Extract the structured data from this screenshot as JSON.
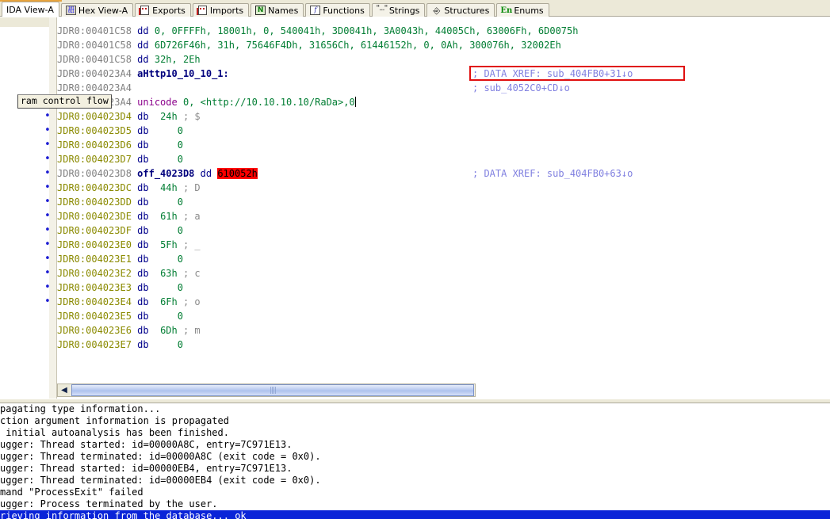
{
  "window": {
    "title": "IDA View-A disassembly"
  },
  "tabs": [
    {
      "label": "IDA View-A",
      "icon": "ida-view-icon",
      "active": true,
      "name": "tab-ida-view-a"
    },
    {
      "label": "Hex View-A",
      "icon": "hex-view-icon",
      "active": false,
      "name": "tab-hex-view-a"
    },
    {
      "label": "Exports",
      "icon": "exports-icon",
      "active": false,
      "name": "tab-exports"
    },
    {
      "label": "Imports",
      "icon": "imports-icon",
      "active": false,
      "name": "tab-imports"
    },
    {
      "label": "Names",
      "icon": "names-icon",
      "active": false,
      "name": "tab-names"
    },
    {
      "label": "Functions",
      "icon": "functions-icon",
      "active": false,
      "name": "tab-functions"
    },
    {
      "label": "Strings",
      "icon": "strings-icon",
      "active": false,
      "name": "tab-strings"
    },
    {
      "label": "Structures",
      "icon": "structures-icon",
      "active": false,
      "name": "tab-structures"
    },
    {
      "label": "Enums",
      "icon": "enums-icon",
      "active": false,
      "name": "tab-enums"
    }
  ],
  "tooltip": {
    "text": "ram control flow"
  },
  "disassembly": {
    "segment": "JDR0",
    "lines": [
      {
        "dot": false,
        "addr": "JDR0:00401C58",
        "addr_style": "gray",
        "mnemonic": "dd",
        "operands": "0, 0FFFFh, 18001h, 0, 540041h, 3D0041h, 3A0043h, 44005Ch, 63006Fh, 6D0075h",
        "comment": ""
      },
      {
        "dot": false,
        "addr": "JDR0:00401C58",
        "addr_style": "gray",
        "mnemonic": "dd",
        "operands": "6D726F46h, 31h, 75646F4Dh, 31656Ch, 61446152h, 0, 0Ah, 300076h, 32002Eh",
        "comment": ""
      },
      {
        "dot": false,
        "addr": "JDR0:00401C58",
        "addr_style": "gray",
        "mnemonic": "dd",
        "operands": "32h, 2Eh",
        "comment": ""
      },
      {
        "dot": false,
        "addr": "JDR0:004023A4",
        "addr_style": "gray",
        "label": "aHttp10_10_10_1:",
        "comment": "; DATA XREF: sub_404FB0+31↓o",
        "comment_boxed": true
      },
      {
        "dot": false,
        "addr": "JDR0:004023A4",
        "addr_style": "gray",
        "comment": "; sub_4052C0+CD↓o"
      },
      {
        "dot": false,
        "addr": "JDR0:004023A4",
        "addr_style": "gray",
        "mnemonic": "unicode",
        "operands": "0, <http://10.10.10.10/RaDa>,0",
        "caret": true
      },
      {
        "dot": true,
        "addr": "JDR0:004023D4",
        "addr_style": "olive",
        "mnemonic": "db",
        "operands": "24h",
        "comment": "; $"
      },
      {
        "dot": true,
        "addr": "JDR0:004023D5",
        "addr_style": "olive",
        "mnemonic": "db",
        "operands": "0"
      },
      {
        "dot": true,
        "addr": "JDR0:004023D6",
        "addr_style": "olive",
        "mnemonic": "db",
        "operands": "0"
      },
      {
        "dot": true,
        "addr": "JDR0:004023D7",
        "addr_style": "olive",
        "mnemonic": "db",
        "operands": "0"
      },
      {
        "dot": true,
        "addr": "JDR0:004023D8",
        "addr_style": "gray",
        "label": "off_4023D8",
        "mnemonic": "dd",
        "operands": "610052h",
        "operand_highlight": true,
        "comment": "; DATA XREF: sub_404FB0+63↓o"
      },
      {
        "dot": true,
        "addr": "JDR0:004023DC",
        "addr_style": "olive",
        "mnemonic": "db",
        "operands": "44h",
        "comment": "; D"
      },
      {
        "dot": true,
        "addr": "JDR0:004023DD",
        "addr_style": "olive",
        "mnemonic": "db",
        "operands": "0"
      },
      {
        "dot": true,
        "addr": "JDR0:004023DE",
        "addr_style": "olive",
        "mnemonic": "db",
        "operands": "61h",
        "comment": "; a"
      },
      {
        "dot": true,
        "addr": "JDR0:004023DF",
        "addr_style": "olive",
        "mnemonic": "db",
        "operands": "0"
      },
      {
        "dot": true,
        "addr": "JDR0:004023E0",
        "addr_style": "olive",
        "mnemonic": "db",
        "operands": "5Fh",
        "comment": "; _"
      },
      {
        "dot": true,
        "addr": "JDR0:004023E1",
        "addr_style": "olive",
        "mnemonic": "db",
        "operands": "0"
      },
      {
        "dot": true,
        "addr": "JDR0:004023E2",
        "addr_style": "olive",
        "mnemonic": "db",
        "operands": "63h",
        "comment": "; c"
      },
      {
        "dot": true,
        "addr": "JDR0:004023E3",
        "addr_style": "olive",
        "mnemonic": "db",
        "operands": "0"
      },
      {
        "dot": true,
        "addr": "JDR0:004023E4",
        "addr_style": "olive",
        "mnemonic": "db",
        "operands": "6Fh",
        "comment": "; o"
      },
      {
        "dot": false,
        "addr": "JDR0:004023E5",
        "addr_style": "olive",
        "mnemonic": "db",
        "operands": "0"
      },
      {
        "dot": false,
        "addr": "JDR0:004023E6",
        "addr_style": "olive",
        "mnemonic": "db",
        "operands": "6Dh",
        "comment": "; m"
      },
      {
        "dot": false,
        "addr": "JDR0:004023E7",
        "addr_style": "olive",
        "mnemonic": "db",
        "operands": "0"
      }
    ]
  },
  "scrollbar": {
    "left_arrow": "◀",
    "grip": "||||"
  },
  "log": {
    "lines": [
      {
        "text": "pagating type information...",
        "selected": false
      },
      {
        "text": "ction argument information is propagated",
        "selected": false
      },
      {
        "text": " initial autoanalysis has been finished.",
        "selected": false
      },
      {
        "text": "ugger: Thread started: id=00000A8C, entry=7C971E13.",
        "selected": false
      },
      {
        "text": "ugger: Thread terminated: id=00000A8C (exit code = 0x0).",
        "selected": false
      },
      {
        "text": "ugger: Thread started: id=00000EB4, entry=7C971E13.",
        "selected": false
      },
      {
        "text": "ugger: Thread terminated: id=00000EB4 (exit code = 0x0).",
        "selected": false
      },
      {
        "text": "mand \"ProcessExit\" failed",
        "selected": false
      },
      {
        "text": "ugger: Process terminated by the user.",
        "selected": false
      },
      {
        "text": "rieving information from the database... ok",
        "selected": true
      }
    ]
  },
  "colors": {
    "chrome": "#ece9d8",
    "addr_gray": "#808080",
    "addr_olive": "#8a8a00",
    "mnemonic_blue": "#00008b",
    "number_green": "#007d32",
    "label_navy": "#00007d",
    "comment_gray": "#8a8a8a",
    "xref_violet": "#8080e0",
    "unicode_magenta": "#8b008b",
    "highlight_red": "#ff0000",
    "selection_blue": "#0a24d8",
    "xref_box_red": "#e01010"
  }
}
